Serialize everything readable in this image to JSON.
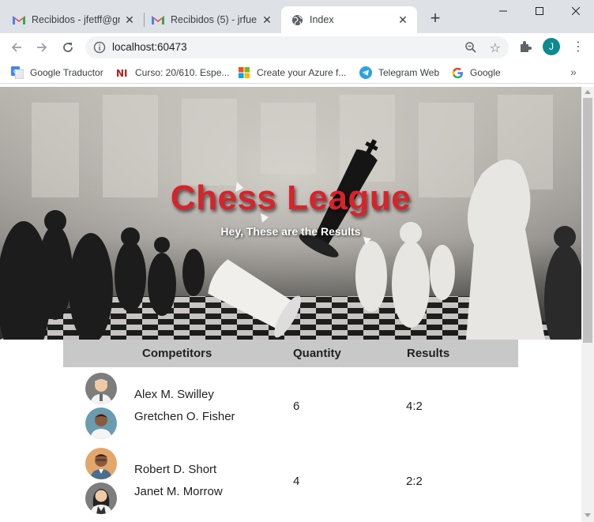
{
  "browser": {
    "tabs": [
      {
        "title": "Recibidos - jfetff@gm",
        "icon": "gmail-icon"
      },
      {
        "title": "Recibidos (5) - jrfuen",
        "icon": "gmail-icon"
      },
      {
        "title": "Index",
        "icon": "globe-icon"
      }
    ],
    "new_tab": "+",
    "url": "localhost:60473",
    "profile_initial": "J",
    "bookmarks": [
      {
        "label": "Google Traductor",
        "icon": "google-translate-icon"
      },
      {
        "label": "Curso: 20/610. Espe...",
        "icon": "ni-icon"
      },
      {
        "label": "Create your Azure f...",
        "icon": "microsoft-icon"
      },
      {
        "label": "Telegram Web",
        "icon": "telegram-icon"
      },
      {
        "label": "Google",
        "icon": "google-icon"
      }
    ],
    "bookmarks_more": "»"
  },
  "hero": {
    "title": "Chess League",
    "subtitle": "Hey, These are the Results"
  },
  "table": {
    "headers": {
      "competitors": "Competitors",
      "quantity": "Quantity",
      "results": "Results"
    },
    "rows": [
      {
        "player1": "Alex M. Swilley",
        "player2": "Gretchen O. Fisher",
        "quantity": "6",
        "result": "4:2"
      },
      {
        "player1": "Robert D. Short",
        "player2": "Janet M. Morrow",
        "quantity": "4",
        "result": "2:2"
      }
    ]
  },
  "colors": {
    "title_red": "#d8232a",
    "header_gray": "#c8c8c8",
    "profile_teal": "#0b8a8f"
  }
}
